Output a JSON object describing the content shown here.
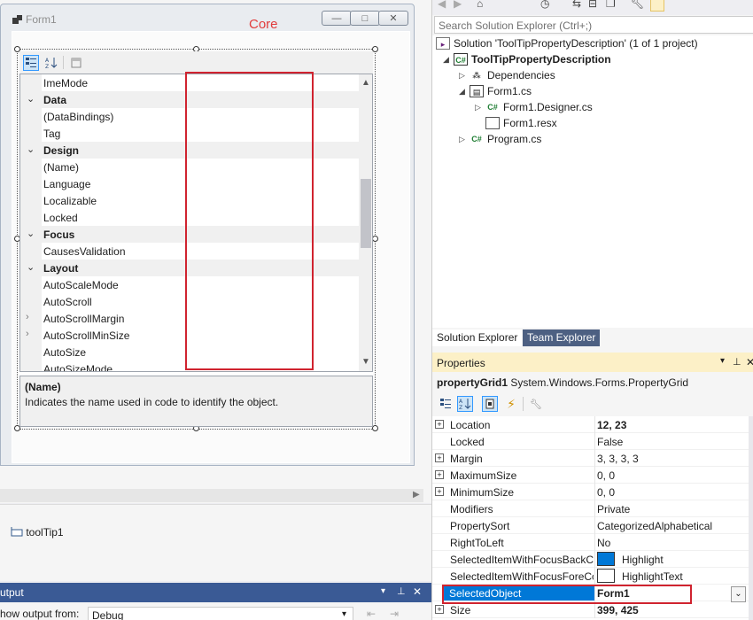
{
  "designer": {
    "form_title": "Form1",
    "annotation": "Core",
    "window_buttons": [
      "—",
      "□",
      "✕"
    ],
    "property_grid": {
      "rows": [
        {
          "label": "ImeMode",
          "type": "prop"
        },
        {
          "label": "Data",
          "type": "cat"
        },
        {
          "label": "(DataBindings)",
          "type": "prop"
        },
        {
          "label": "Tag",
          "type": "prop"
        },
        {
          "label": "Design",
          "type": "cat"
        },
        {
          "label": "(Name)",
          "type": "prop"
        },
        {
          "label": "Language",
          "type": "prop"
        },
        {
          "label": "Localizable",
          "type": "prop"
        },
        {
          "label": "Locked",
          "type": "prop"
        },
        {
          "label": "Focus",
          "type": "cat"
        },
        {
          "label": "CausesValidation",
          "type": "prop"
        },
        {
          "label": "Layout",
          "type": "cat"
        },
        {
          "label": "AutoScaleMode",
          "type": "prop"
        },
        {
          "label": "AutoScroll",
          "type": "prop"
        },
        {
          "label": "AutoScrollMargin",
          "type": "expprop"
        },
        {
          "label": "AutoScrollMinSize",
          "type": "expprop"
        },
        {
          "label": "AutoSize",
          "type": "prop"
        },
        {
          "label": "AutoSizeMode",
          "type": "prop"
        }
      ],
      "description_title": "(Name)",
      "description_text": "Indicates the name used in code to identify the object."
    },
    "tray_component": "toolTip1"
  },
  "output": {
    "title": "utput",
    "show_from_label": "how output from:",
    "source": "Debug"
  },
  "solution_explorer": {
    "search_placeholder": "Search Solution Explorer (Ctrl+;)",
    "solution": "Solution 'ToolTipPropertyDescription' (1 of 1 project)",
    "project": "ToolTipPropertyDescription",
    "items": {
      "dependencies": "Dependencies",
      "form1": "Form1.cs",
      "form1_designer": "Form1.Designer.cs",
      "form1_resx": "Form1.resx",
      "program": "Program.cs"
    },
    "tabs": {
      "solution_explorer": "Solution Explorer",
      "team_explorer": "Team Explorer"
    }
  },
  "properties": {
    "title": "Properties",
    "object_name": "propertyGrid1",
    "object_type": "System.Windows.Forms.PropertyGrid",
    "rows": [
      {
        "name": "Location",
        "value": "12, 23",
        "expand": true,
        "bold": true
      },
      {
        "name": "Locked",
        "value": "False",
        "expand": false
      },
      {
        "name": "Margin",
        "value": "3, 3, 3, 3",
        "expand": true
      },
      {
        "name": "MaximumSize",
        "value": "0, 0",
        "expand": true
      },
      {
        "name": "MinimumSize",
        "value": "0, 0",
        "expand": true
      },
      {
        "name": "Modifiers",
        "value": "Private",
        "expand": false
      },
      {
        "name": "PropertySort",
        "value": "CategorizedAlphabetical",
        "expand": false
      },
      {
        "name": "RightToLeft",
        "value": "No",
        "expand": false
      },
      {
        "name": "SelectedItemWithFocusBackCo",
        "value": "Highlight",
        "swatch": "#0078d7"
      },
      {
        "name": "SelectedItemWithFocusForeCo",
        "value": "HighlightText",
        "swatch": "#ffffff"
      },
      {
        "name": "SelectedObject",
        "value": "Form1",
        "selected": true,
        "bold": true
      },
      {
        "name": "Size",
        "value": "399, 425",
        "expand": true,
        "bold": true
      }
    ]
  },
  "colors": {
    "accent": "#0078d7",
    "annotation_red": "#d0232f",
    "properties_title_bg": "#fcf0c7"
  }
}
